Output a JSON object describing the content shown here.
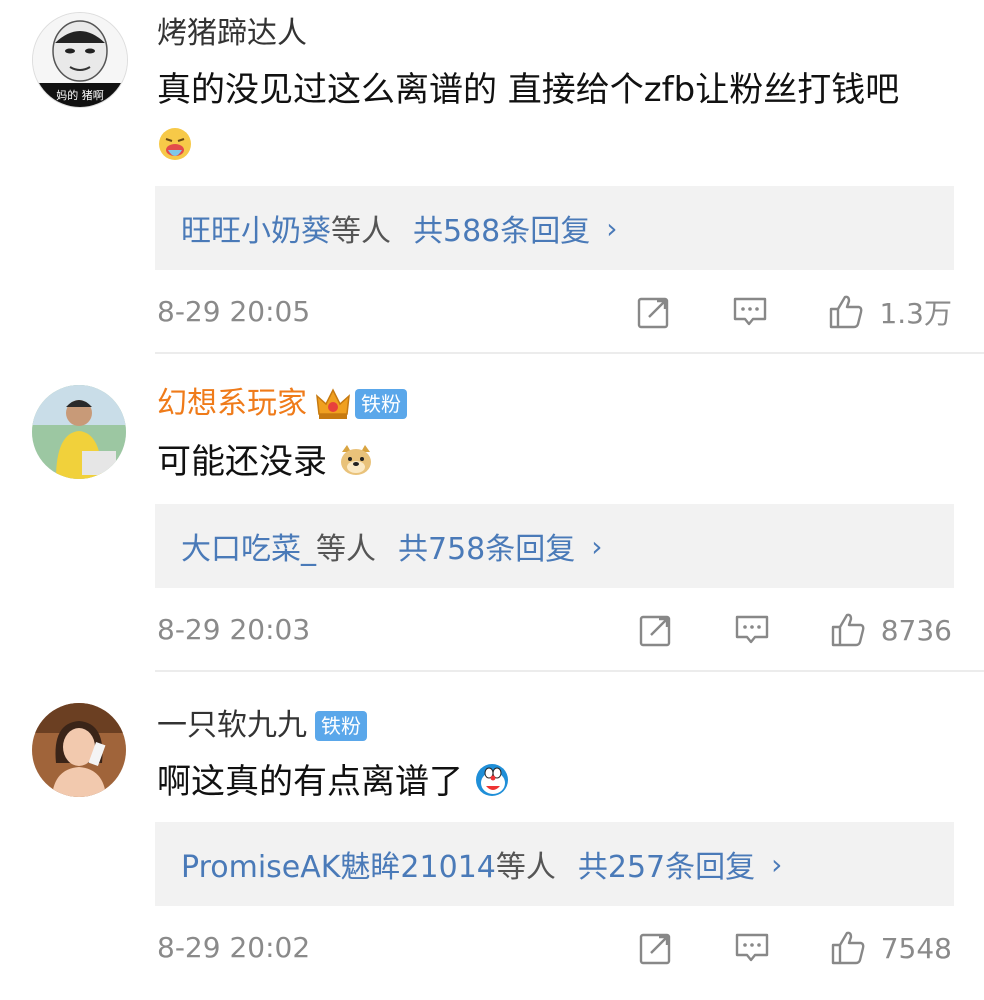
{
  "comments": [
    {
      "username": "烤猪蹄达人",
      "text": "真的没见过这么离谱的 直接给个zfb让粉丝打钱吧",
      "emoji_name": "vomit-emoji",
      "reply_names": "旺旺小奶葵",
      "reply_etc": "等人",
      "reply_count": "共588条回复",
      "time": "8-29 20:05",
      "likes": "1.3万",
      "avatar_caption": "妈的 猪啊"
    },
    {
      "username": "幻想系玩家",
      "badge": "铁粉",
      "text": "可能还没录",
      "emoji_name": "doge-emoji",
      "reply_names": "大口吃菜_",
      "reply_etc": "等人",
      "reply_count": "共758条回复",
      "time": "8-29 20:03",
      "likes": "8736"
    },
    {
      "username": "一只软九九",
      "badge": "铁粉",
      "text": "啊这真的有点离谱了",
      "emoji_name": "doraemon-emoji",
      "reply_names": "PromiseAK魅眸21014",
      "reply_etc": "等人",
      "reply_count": "共257条回复",
      "time": "8-29 20:02",
      "likes": "7548"
    }
  ],
  "chevron": "›",
  "colors": {
    "link": "#4a7ab8",
    "vip_name": "#ef7b1a",
    "fan_badge": "#5aa7ea",
    "meta": "#8a8a8a"
  }
}
